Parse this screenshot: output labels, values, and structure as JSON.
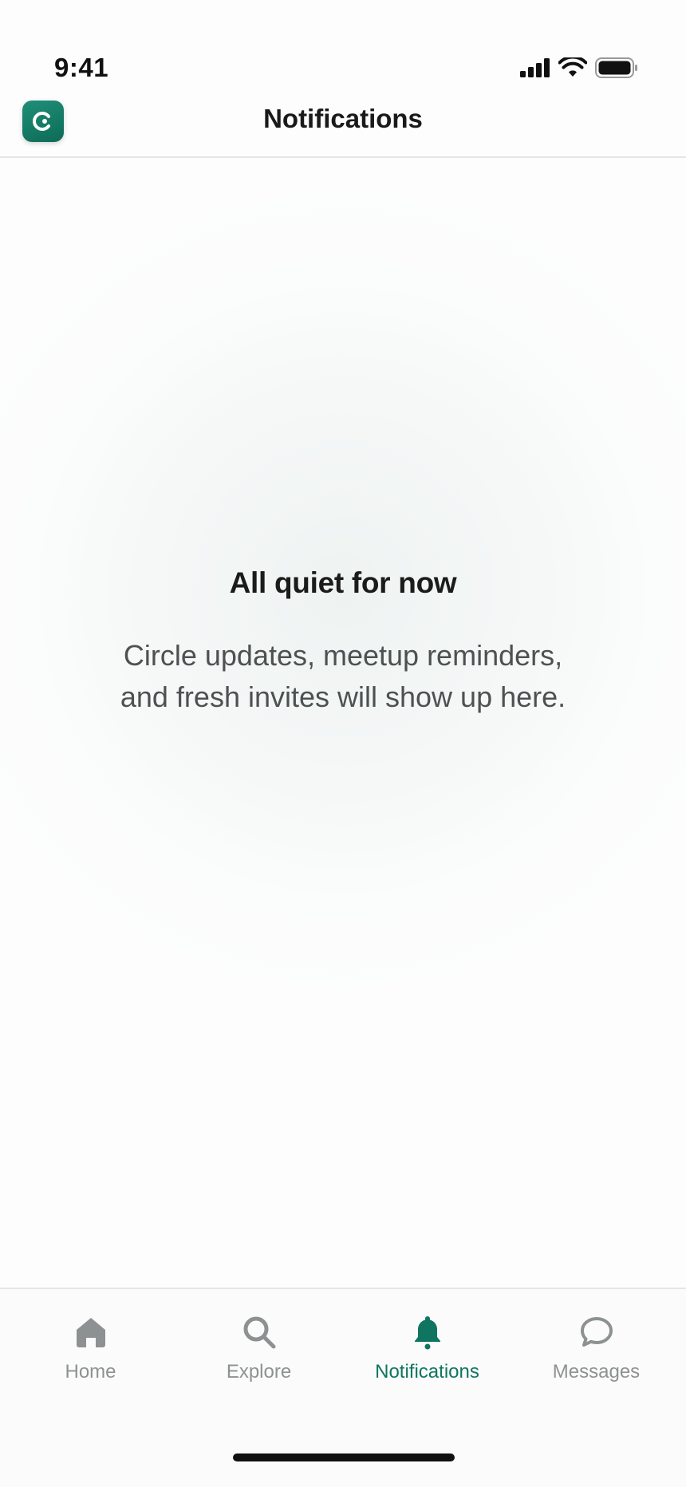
{
  "status_bar": {
    "time": "9:41"
  },
  "header": {
    "title": "Notifications"
  },
  "empty_state": {
    "title": "All quiet for now",
    "line1": "Circle updates, meetup reminders,",
    "line2": "and fresh invites will show up here."
  },
  "tabs": [
    {
      "label": "Home",
      "icon": "home-icon",
      "active": false
    },
    {
      "label": "Explore",
      "icon": "search-icon",
      "active": false
    },
    {
      "label": "Notifications",
      "icon": "bell-icon",
      "active": true
    },
    {
      "label": "Messages",
      "icon": "chat-bubble-icon",
      "active": false
    }
  ],
  "colors": {
    "accent": "#0f7560",
    "inactive": "#8e9192",
    "logo": "#137e68"
  }
}
